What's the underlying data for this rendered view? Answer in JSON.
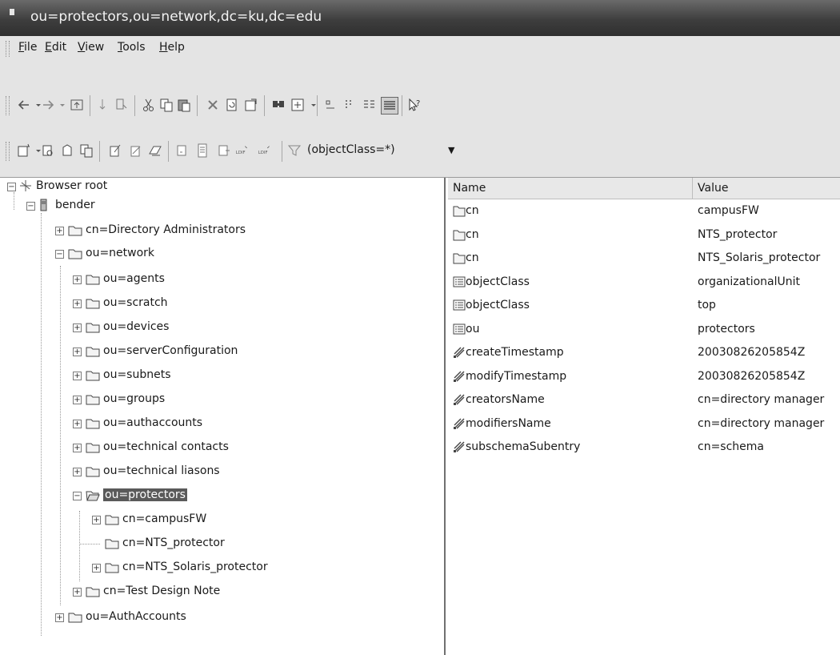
{
  "window": {
    "title": "ou=protectors,ou=network,dc=ku,dc=edu"
  },
  "menu": [
    {
      "u": "F",
      "rest": "ile"
    },
    {
      "u": "E",
      "rest": "dit"
    },
    {
      "u": "V",
      "rest": "iew"
    },
    {
      "u": "T",
      "rest": "ools"
    },
    {
      "u": "H",
      "rest": "elp"
    }
  ],
  "toolbar": {
    "filter_value": "(objectClass=*)",
    "ldif_label": "LDIF"
  },
  "tree": {
    "root": "Browser root",
    "server": "bender",
    "items": {
      "dir_admins": "cn=Directory Administrators",
      "network": "ou=network",
      "agents": "ou=agents",
      "scratch": "ou=scratch",
      "devices": "ou=devices",
      "serverconfig": "ou=serverConfiguration",
      "subnets": "ou=subnets",
      "groups": "ou=groups",
      "authaccounts": "ou=authaccounts",
      "tech_contacts": "ou=technical contacts",
      "tech_liasons": "ou=technical liasons",
      "protectors": "ou=protectors",
      "campusfw": "cn=campusFW",
      "nts_protector": "cn=NTS_protector",
      "nts_solaris": "cn=NTS_Solaris_protector",
      "test_design": "cn=Test Design Note",
      "authaccounts_top": "ou=AuthAccounts"
    }
  },
  "attributes": {
    "columns": {
      "name": "Name",
      "value": "Value"
    },
    "rows": [
      {
        "name": "cn",
        "value": "campusFW",
        "icon": "folder-icon"
      },
      {
        "name": "cn",
        "value": "NTS_protector",
        "icon": "folder-icon"
      },
      {
        "name": "cn",
        "value": "NTS_Solaris_protector",
        "icon": "folder-icon"
      },
      {
        "name": "objectClass",
        "value": "organizationalUnit",
        "icon": "list-icon"
      },
      {
        "name": "objectClass",
        "value": "top",
        "icon": "list-icon"
      },
      {
        "name": "ou",
        "value": "protectors",
        "icon": "list-icon"
      },
      {
        "name": "createTimestamp",
        "value": "20030826205854Z",
        "icon": "operational-attribute-icon"
      },
      {
        "name": "modifyTimestamp",
        "value": "20030826205854Z",
        "icon": "operational-attribute-icon"
      },
      {
        "name": "creatorsName",
        "value": "cn=directory manager",
        "icon": "operational-attribute-icon"
      },
      {
        "name": "modifiersName",
        "value": "cn=directory manager",
        "icon": "operational-attribute-icon"
      },
      {
        "name": "subschemaSubentry",
        "value": "cn=schema",
        "icon": "operational-attribute-icon"
      }
    ]
  }
}
